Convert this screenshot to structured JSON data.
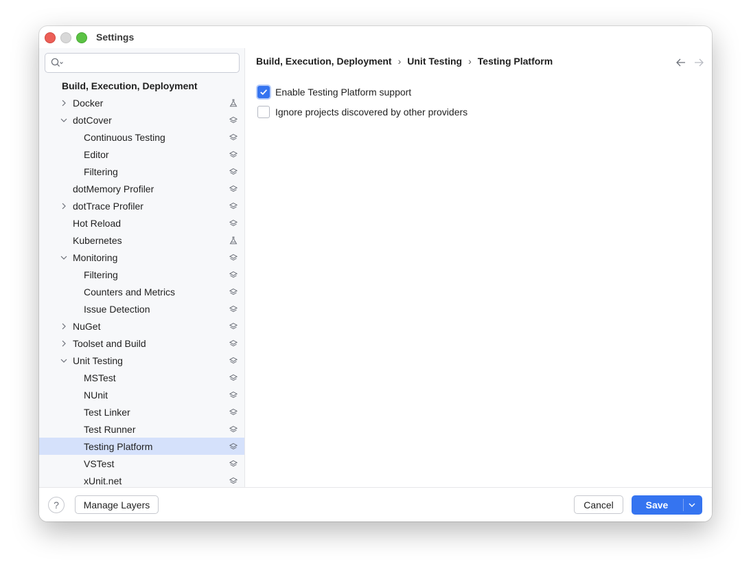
{
  "window": {
    "title": "Settings"
  },
  "search": {
    "placeholder": "",
    "value": ""
  },
  "sidebar": {
    "items": [
      {
        "label": "Build, Execution, Deployment",
        "level": 0,
        "group": true,
        "chevron": "none",
        "icon": "none",
        "selected": false
      },
      {
        "label": "Docker",
        "level": 1,
        "chevron": "right",
        "icon": "flask-icon",
        "selected": false
      },
      {
        "label": "dotCover",
        "level": 1,
        "chevron": "down",
        "icon": "layers-icon",
        "selected": false
      },
      {
        "label": "Continuous Testing",
        "level": 2,
        "chevron": "none",
        "icon": "layers-icon",
        "selected": false
      },
      {
        "label": "Editor",
        "level": 2,
        "chevron": "none",
        "icon": "layers-icon",
        "selected": false
      },
      {
        "label": "Filtering",
        "level": 2,
        "chevron": "none",
        "icon": "layers-icon",
        "selected": false
      },
      {
        "label": "dotMemory Profiler",
        "level": 1,
        "chevron": "none",
        "icon": "layers-icon",
        "selected": false
      },
      {
        "label": "dotTrace Profiler",
        "level": 1,
        "chevron": "right",
        "icon": "layers-icon",
        "selected": false
      },
      {
        "label": "Hot Reload",
        "level": 1,
        "chevron": "none",
        "icon": "layers-icon",
        "selected": false
      },
      {
        "label": "Kubernetes",
        "level": 1,
        "chevron": "none",
        "icon": "flask-icon",
        "selected": false
      },
      {
        "label": "Monitoring",
        "level": 1,
        "chevron": "down",
        "icon": "layers-icon",
        "selected": false
      },
      {
        "label": "Filtering",
        "level": 2,
        "chevron": "none",
        "icon": "layers-icon",
        "selected": false
      },
      {
        "label": "Counters and Metrics",
        "level": 2,
        "chevron": "none",
        "icon": "layers-icon",
        "selected": false
      },
      {
        "label": "Issue Detection",
        "level": 2,
        "chevron": "none",
        "icon": "layers-icon",
        "selected": false
      },
      {
        "label": "NuGet",
        "level": 1,
        "chevron": "right",
        "icon": "layers-icon",
        "selected": false
      },
      {
        "label": "Toolset and Build",
        "level": 1,
        "chevron": "right",
        "icon": "layers-icon",
        "selected": false
      },
      {
        "label": "Unit Testing",
        "level": 1,
        "chevron": "down",
        "icon": "layers-icon",
        "selected": false
      },
      {
        "label": "MSTest",
        "level": 2,
        "chevron": "none",
        "icon": "layers-icon",
        "selected": false
      },
      {
        "label": "NUnit",
        "level": 2,
        "chevron": "none",
        "icon": "layers-icon",
        "selected": false
      },
      {
        "label": "Test Linker",
        "level": 2,
        "chevron": "none",
        "icon": "layers-icon",
        "selected": false
      },
      {
        "label": "Test Runner",
        "level": 2,
        "chevron": "none",
        "icon": "layers-icon",
        "selected": false
      },
      {
        "label": "Testing Platform",
        "level": 2,
        "chevron": "none",
        "icon": "layers-icon",
        "selected": true
      },
      {
        "label": "VSTest",
        "level": 2,
        "chevron": "none",
        "icon": "layers-icon",
        "selected": false
      },
      {
        "label": "xUnit.net",
        "level": 2,
        "chevron": "none",
        "icon": "layers-icon",
        "selected": false
      }
    ]
  },
  "breadcrumb": {
    "parts": [
      "Build, Execution, Deployment",
      "Unit Testing",
      "Testing Platform"
    ],
    "separator": "›"
  },
  "options": [
    {
      "label": "Enable Testing Platform support",
      "checked": true
    },
    {
      "label": "Ignore projects discovered by other providers",
      "checked": false
    }
  ],
  "footer": {
    "help_label": "?",
    "manage_layers_label": "Manage Layers",
    "cancel_label": "Cancel",
    "save_label": "Save"
  },
  "colors": {
    "accent": "#3574f0",
    "selection": "#d5e1fb",
    "sidebar_bg": "#f7f8fa"
  }
}
